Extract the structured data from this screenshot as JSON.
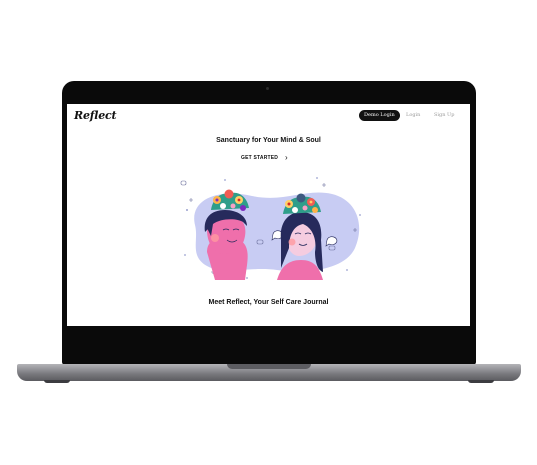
{
  "nav": {
    "logo": "Reflect",
    "demo_login": "Demo Login",
    "login": "Login",
    "signup": "Sign Up"
  },
  "hero": {
    "tagline": "Sanctuary for Your Mind & Soul",
    "cta_label": "GET STARTED",
    "cta_icon": "chevron-right-icon",
    "headline": "Meet Reflect, Your Self Care Journal"
  },
  "colors": {
    "accent": "#111111",
    "blob": "#c8ccf3",
    "skin": "#ef6fab",
    "hair": "#262a5c"
  }
}
